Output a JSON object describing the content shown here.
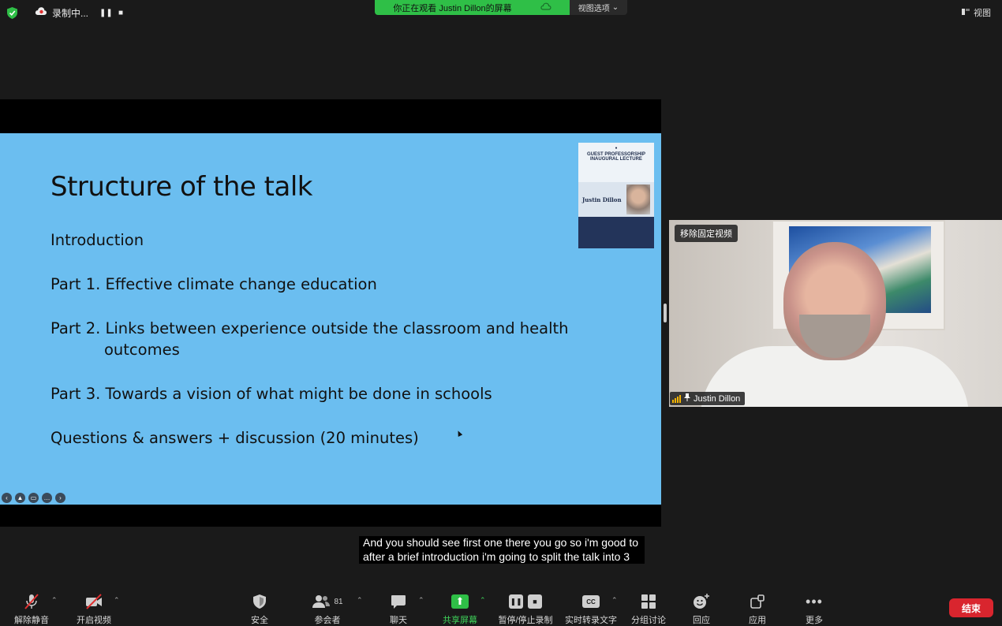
{
  "recording": {
    "label": "录制中..."
  },
  "banner": {
    "viewing_text": "你正在观看 Justin Dillon的屏幕",
    "view_options": "视图选项"
  },
  "top_right": {
    "view_label": "视图"
  },
  "slide": {
    "title": "Structure of the talk",
    "lines": [
      "Introduction",
      "Part 1. Effective climate change education",
      "Part 2. Links between experience outside the classroom and health",
      "outcomes",
      "Part 3. Towards a vision of what might be done in schools",
      "Questions & answers + discussion (20 minutes)"
    ],
    "poster": {
      "heading": "GUEST PROFESSORSHIP INAUGURAL LECTURE",
      "name": "Justin Dillon"
    }
  },
  "video": {
    "unpin_label": "移除固定视频",
    "participant_name": "Justin Dillon"
  },
  "caption": {
    "text": "And you should see first one there you go so i'm good to after a brief introduction i'm going to split the talk into 3"
  },
  "toolbar": {
    "unmute": "解除静音",
    "start_video": "开启视频",
    "security": "安全",
    "participants": "参会者",
    "participants_count": "81",
    "chat": "聊天",
    "share_screen": "共享屏幕",
    "pause_stop_recording": "暂停/停止录制",
    "live_transcript": "实时转录文字",
    "breakout_rooms": "分组讨论",
    "reactions": "回应",
    "apps": "应用",
    "more": "更多",
    "end": "结束"
  },
  "colors": {
    "share_green": "#2fbf47",
    "end_red": "#d9252e",
    "slide_blue": "#6bbef0"
  }
}
